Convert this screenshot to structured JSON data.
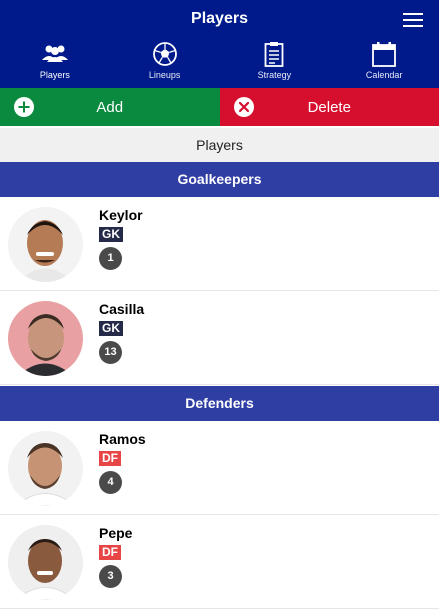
{
  "header": {
    "title": "Players"
  },
  "nav": {
    "items": [
      {
        "label": "Players",
        "icon": "players-icon",
        "active": true
      },
      {
        "label": "Lineups",
        "icon": "ball-icon",
        "active": false
      },
      {
        "label": "Strategy",
        "icon": "clipboard-icon",
        "active": false
      },
      {
        "label": "Calendar",
        "icon": "calendar-icon",
        "active": false
      }
    ]
  },
  "actions": {
    "add_label": "Add",
    "delete_label": "Delete",
    "add_color": "#0a8a3e",
    "delete_color": "#d60f2e"
  },
  "list": {
    "title": "Players",
    "sections": [
      {
        "name": "Goalkeepers",
        "players": [
          {
            "name": "Keylor",
            "position": "GK",
            "number": "1"
          },
          {
            "name": "Casilla",
            "position": "GK",
            "number": "13"
          }
        ]
      },
      {
        "name": "Defenders",
        "players": [
          {
            "name": "Ramos",
            "position": "DF",
            "number": "4"
          },
          {
            "name": "Pepe",
            "position": "DF",
            "number": "3"
          }
        ]
      }
    ]
  },
  "colors": {
    "header_bg": "#001a8c",
    "section_bg": "#2f3ea3",
    "gk_badge": "#252a49",
    "df_badge": "#e84646",
    "number_badge": "#4a4a4a"
  }
}
